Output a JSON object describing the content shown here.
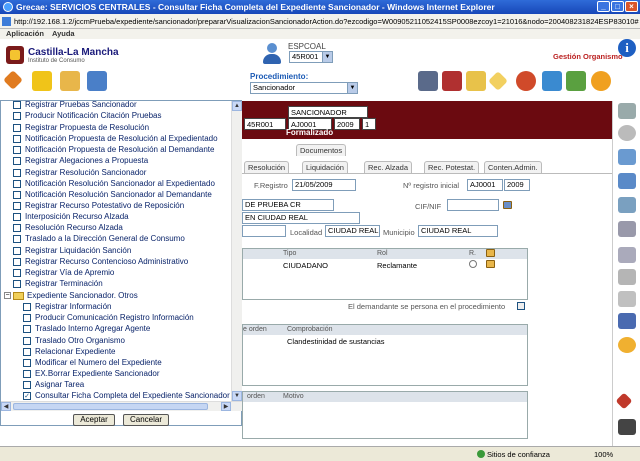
{
  "window": {
    "title": "Grecae: SERVICIOS CENTRALES - Consultar Ficha Completa del Expediente Sancionador - Windows Internet Explorer",
    "url": "http://192.168.1.2/jccmPrueba/expediente/sancionador/prepararVisualizacionSancionadorAction.do?ezcodigo=W00905211052415SP0008ezcoy1=21016&nodo=200408231824ESP83010#"
  },
  "menu": [
    "Aplicación",
    "Ayuda"
  ],
  "header": {
    "logo_title": "Castilla-La Mancha",
    "logo_subtitle": "Instituto de Consumo",
    "user_label": "ESPCOAL",
    "user_value": "45R001",
    "gestion_link": "Gestión Organismo",
    "procedure_label": "Procedimiento:",
    "procedure_value": "Sancionador"
  },
  "expediente": {
    "type": "SANCIONADOR",
    "codes": [
      "45R001",
      "AJ0001",
      "2009",
      "1"
    ],
    "status": "Formalizado",
    "documents_tab": "Documentos"
  },
  "tabs": [
    "Resolución",
    "Liquidación",
    "Rec. Alzada",
    "Rec. Potestat.",
    "Conten.Admin."
  ],
  "registro": {
    "f_registro_label": "F.Registro",
    "f_registro_value": "21/05/2009",
    "nro_registro_label": "Nº registro inicial",
    "nro_registro_value": "AJ0001",
    "nro_registro_year": "2009"
  },
  "persona": {
    "name_value": "DE PRUEBA CR",
    "cif_label": "CIF/NIF",
    "address_value": "EN CIUDAD REAL",
    "localidad_label": "Localidad",
    "localidad_value": "CIUDAD REAL",
    "municipio_label": "Municipio",
    "municipio_value": "CIUDAD REAL"
  },
  "interesados": {
    "headers": [
      "Tipo",
      "Rol",
      "R."
    ],
    "rows": [
      [
        "CIUDADANO",
        "Reclamante"
      ]
    ],
    "note": "El demandante se persona en el procedimiento"
  },
  "comprobaciones": {
    "headers": [
      "e orden",
      "Comprobación"
    ],
    "rows": [
      [
        "Clandestinidad de sustancias"
      ]
    ]
  },
  "motivos": {
    "headers": [
      "orden",
      "Motivo"
    ]
  },
  "tree": {
    "items": [
      "Registrar Pruebas Sancionador",
      "Producir Notificación Citación Pruebas",
      "Registrar Propuesta de Resolución",
      "Notificación Propuesta de Resolución al Expedientado",
      "Notificación Propuesta de Resolución al Demandante",
      "Registrar Alegaciones a Propuesta",
      "Registrar Resolución Sancionador",
      "Notificación Resolución Sancionador al Expedientado",
      "Notificación Resolución Sancionador al Demandante",
      "Registrar Recurso Potestativo de Reposición",
      "Interposición Recurso Alzada",
      "Resolución Recurso Alzada",
      "Traslado a la Dirección General de Consumo",
      "Registrar Liquidación Sanción",
      "Registrar Recurso Contencioso Administrativo",
      "Registrar Vía de Apremio",
      "Registrar Terminación"
    ],
    "group_label": "Expediente Sancionador. Otros",
    "group_items": [
      "Registrar Información",
      "Producir Comunicación Registro Información",
      "Traslado Interno Agregar Agente",
      "Traslado Otro Organismo",
      "Relacionar Expediente",
      "Modificar el Numero del Expediente",
      "EX.Borrar Expediente Sancionador",
      "Asignar Tarea",
      "Consultar Ficha Completa del Expediente Sancionador"
    ],
    "accept_label": "Aceptar",
    "cancel_label": "Cancelar"
  },
  "status": {
    "zone": "Sitios de confianza",
    "zoom": "100%"
  },
  "colors": {
    "banner": "#6b0a10",
    "link": "#0a246a",
    "title_bar": "#1747b8"
  }
}
